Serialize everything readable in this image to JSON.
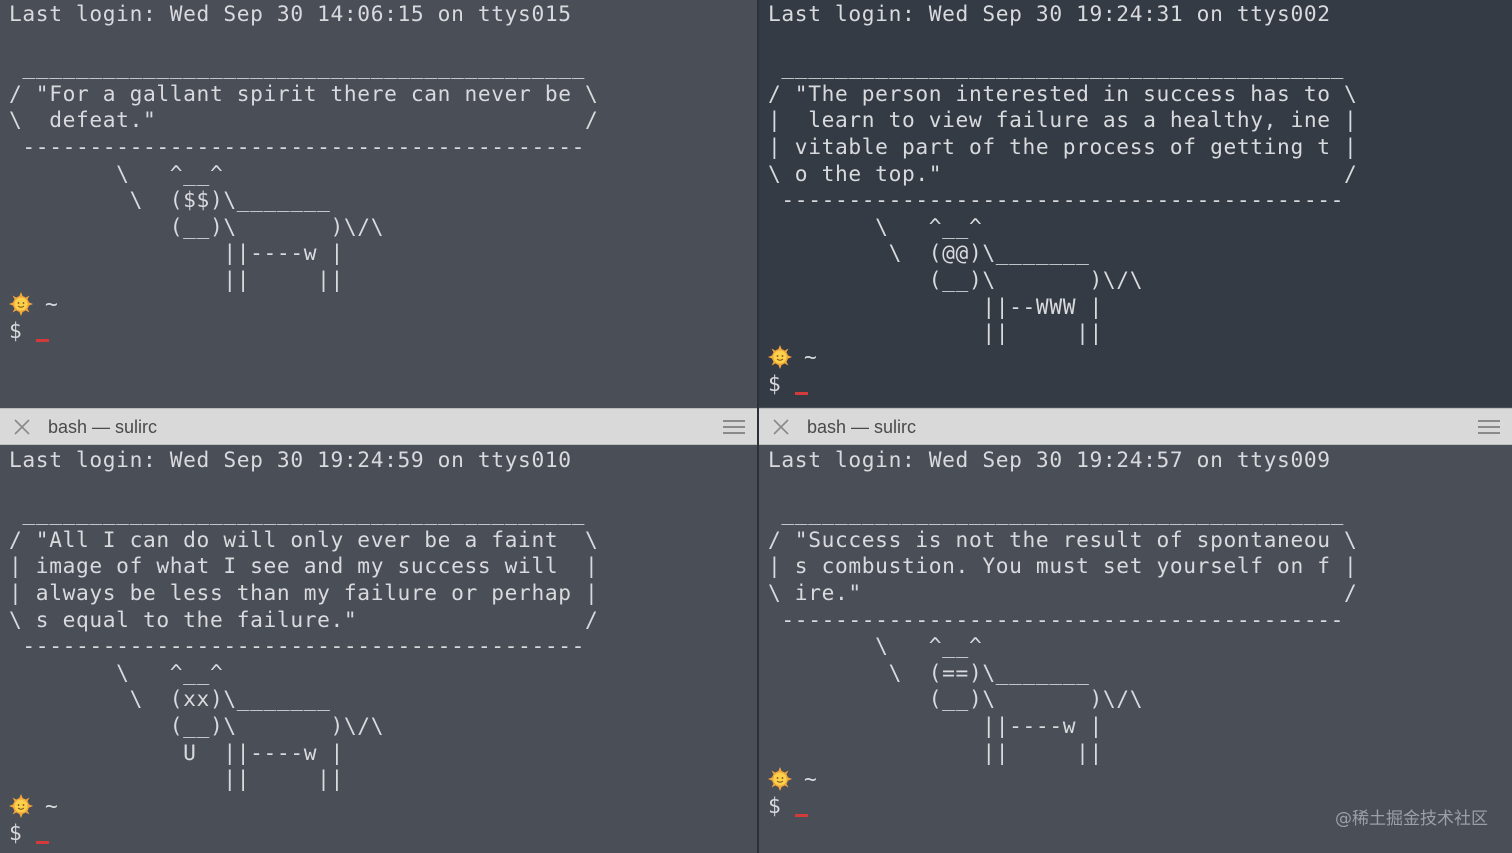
{
  "panes": [
    {
      "id": "top-left",
      "lines": [
        "Last login: Wed Sep 30 14:06:15 on ttys015",
        "",
        " __________________________________________",
        "/ \"For a gallant spirit there can never be \\",
        "\\  defeat.\"                                /",
        " ------------------------------------------",
        "        \\   ^__^",
        "         \\  ($$)\\_______",
        "            (__)\\       )\\/\\",
        "                ||----w |",
        "                ||     ||"
      ],
      "prompt_dir": "~",
      "prompt_symbol": "$"
    },
    {
      "id": "top-right",
      "lines": [
        "Last login: Wed Sep 30 19:24:31 on ttys002",
        "",
        " __________________________________________",
        "/ \"The person interested in success has to \\",
        "|  learn to view failure as a healthy, ine |",
        "| vitable part of the process of getting t |",
        "\\ o the top.\"                              /",
        " ------------------------------------------",
        "        \\   ^__^",
        "         \\  (@@)\\_______",
        "            (__)\\       )\\/\\",
        "                ||--WWW |",
        "                ||     ||"
      ],
      "prompt_dir": "~",
      "prompt_symbol": "$"
    },
    {
      "id": "bottom-left",
      "lines": [
        "Last login: Wed Sep 30 19:24:59 on ttys010",
        "",
        " __________________________________________",
        "/ \"All I can do will only ever be a faint  \\",
        "| image of what I see and my success will  |",
        "| always be less than my failure or perhap |",
        "\\ s equal to the failure.\"                 /",
        " ------------------------------------------",
        "        \\   ^__^",
        "         \\  (xx)\\_______",
        "            (__)\\       )\\/\\",
        "             U  ||----w |",
        "                ||     ||"
      ],
      "prompt_dir": "~",
      "prompt_symbol": "$"
    },
    {
      "id": "bottom-right",
      "lines": [
        "Last login: Wed Sep 30 19:24:57 on ttys009",
        "",
        " __________________________________________",
        "/ \"Success is not the result of spontaneou \\",
        "| s combustion. You must set yourself on f |",
        "\\ ire.\"                                    /",
        " ------------------------------------------",
        "        \\   ^__^",
        "         \\  (==)\\_______",
        "            (__)\\       )\\/\\",
        "                ||----w |",
        "                ||     ||"
      ],
      "prompt_dir": "~",
      "prompt_symbol": "$"
    }
  ],
  "tabs": {
    "left": {
      "title": "bash — sulirc"
    },
    "right": {
      "title": "bash — sulirc"
    }
  },
  "colors": {
    "inactive_bg": "#4a4e57",
    "active_bg": "#353b45",
    "text": "#d8dadd",
    "cursor": "#d33a3a",
    "tabbar_bg": "#d9d9d9"
  },
  "icons": {
    "prompt": "sun-face-icon",
    "tab_close": "close-icon",
    "tab_menu": "hamburger-menu-icon"
  },
  "watermark": "@稀土掘金技术社区"
}
